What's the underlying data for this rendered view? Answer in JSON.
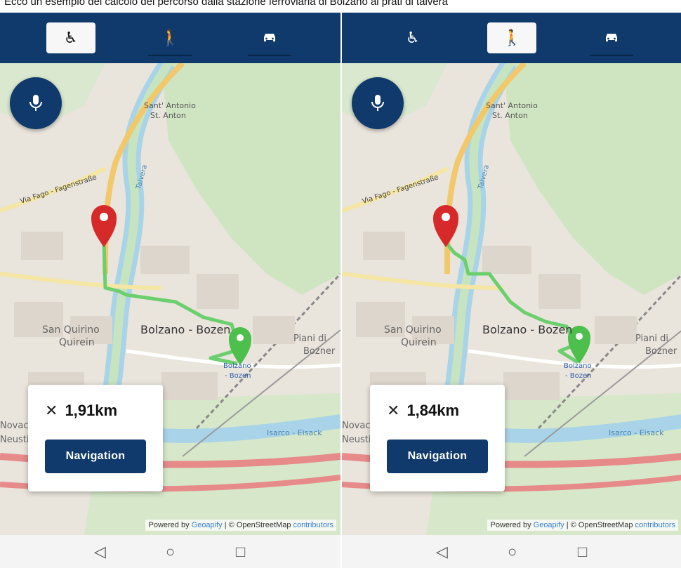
{
  "caption": "Ecco un esempio del calcolo del percorso dalla stazione ferroviaria di Bolzano ai prati di talvera",
  "colors": {
    "header": "#0f3a6b",
    "route": "#6ccf6e",
    "start_pin": "#d62a2a",
    "end_pin": "#4cbf4c",
    "map_bg": "#f2efe9",
    "park": "#cfe5c2"
  },
  "map_labels": {
    "st_antonio_it": "Sant' Antonio",
    "st_antonio_de": "St. Anton",
    "via_fago": "Via Fago - Fagenstraße",
    "bolzano": "Bolzano - Bozen",
    "san_quirino": "San Quirino",
    "quirein": "Quirein",
    "piani_di": "Piani di",
    "bozner": "Bozner",
    "station_it": "Bolzano",
    "station_de": "- Bozen",
    "talvera": "Talvera",
    "isarco": "Isarco - Eisack",
    "novacella": "Novacella",
    "neustift": "Neustift"
  },
  "icons": {
    "wheelchair": "wheelchair-icon",
    "walk": "walking-icon",
    "car": "car-icon",
    "mic": "microphone-icon",
    "close": "close-icon",
    "back": "back-icon",
    "home": "home-icon",
    "recents": "recents-icon"
  },
  "phones": [
    {
      "active_mode": "wheelchair",
      "modes": {
        "wheelchair": "♿",
        "walk": "🚶",
        "car": "🚗"
      },
      "close_symbol": "✕",
      "distance": "1,91km",
      "nav_label": "Navigation",
      "attribution": {
        "powered": "Powered by ",
        "geoapify": "Geoapify",
        "osm": " | © OpenStreetMap ",
        "contributors": "contributors"
      },
      "navbar": {
        "back": "◁",
        "home": "○",
        "recents": "□"
      }
    },
    {
      "active_mode": "walk",
      "modes": {
        "wheelchair": "♿",
        "walk": "🚶",
        "car": "🚗"
      },
      "close_symbol": "✕",
      "distance": "1,84km",
      "nav_label": "Navigation",
      "attribution": {
        "powered": "Powered by ",
        "geoapify": "Geoapify",
        "osm": " | © OpenStreetMap ",
        "contributors": "contributors"
      },
      "navbar": {
        "back": "◁",
        "home": "○",
        "recents": "□"
      }
    }
  ]
}
